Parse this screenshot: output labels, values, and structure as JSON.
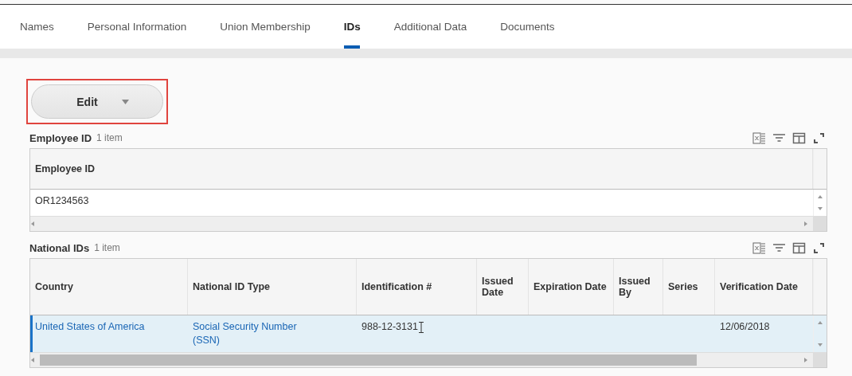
{
  "tabs": [
    {
      "label": "Names",
      "selected": false
    },
    {
      "label": "Personal Information",
      "selected": false
    },
    {
      "label": "Union Membership",
      "selected": false
    },
    {
      "label": "IDs",
      "selected": true
    },
    {
      "label": "Additional Data",
      "selected": false
    },
    {
      "label": "Documents",
      "selected": false
    }
  ],
  "edit_button": {
    "label": "Edit",
    "highlighted": true
  },
  "tables": [
    {
      "title": "Employee ID",
      "count": "1 item",
      "columns": [
        "Employee ID"
      ],
      "rows": [
        {
          "selected": false,
          "cells": [
            {
              "text": "OR1234563",
              "link": false
            }
          ]
        }
      ]
    },
    {
      "title": "National IDs",
      "count": "1 item",
      "columns": [
        "Country",
        "National ID Type",
        "Identification #",
        "Issued Date",
        "Expiration Date",
        "Issued By",
        "Series",
        "Verification Date"
      ],
      "rows": [
        {
          "selected": true,
          "cells": [
            {
              "text": "United States of America",
              "link": true
            },
            {
              "text": "Social Security Number (SSN)",
              "link": true
            },
            {
              "text": "988-12-3131",
              "link": false,
              "cursor": true
            },
            {
              "text": "",
              "link": false
            },
            {
              "text": "",
              "link": false
            },
            {
              "text": "",
              "link": false
            },
            {
              "text": "",
              "link": false
            },
            {
              "text": "12/06/2018",
              "link": false
            }
          ]
        }
      ]
    }
  ]
}
